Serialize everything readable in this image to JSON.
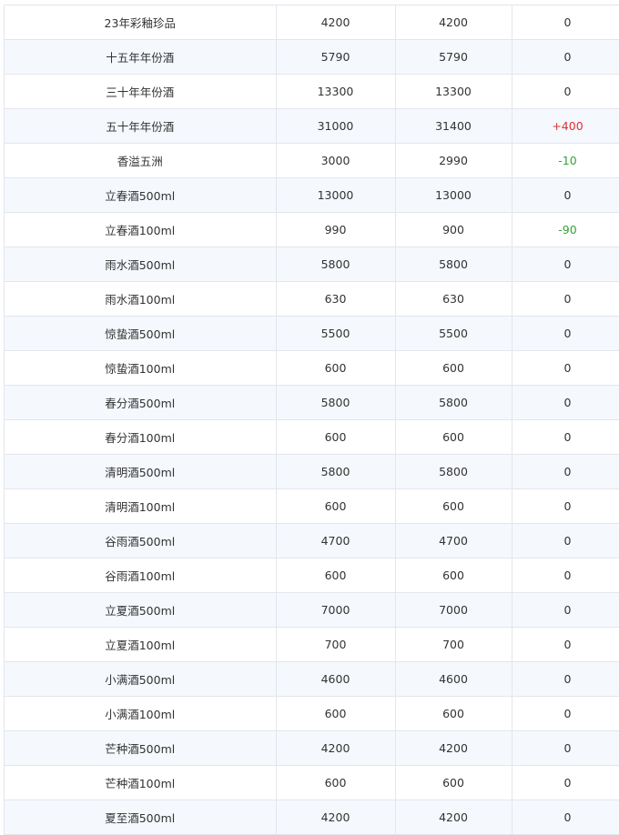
{
  "colors": {
    "up": "#e03131",
    "down": "#35a335",
    "neutral": "#333333",
    "stripe": "#f5f8fd",
    "border": "#e3e6ec"
  },
  "rows": [
    {
      "name": "23年彩釉珍品",
      "prev": "4200",
      "curr": "4200",
      "diff": "0"
    },
    {
      "name": "十五年年份酒",
      "prev": "5790",
      "curr": "5790",
      "diff": "0"
    },
    {
      "name": "三十年年份酒",
      "prev": "13300",
      "curr": "13300",
      "diff": "0"
    },
    {
      "name": "五十年年份酒",
      "prev": "31000",
      "curr": "31400",
      "diff": "+400"
    },
    {
      "name": "香溢五洲",
      "prev": "3000",
      "curr": "2990",
      "diff": "-10"
    },
    {
      "name": "立春酒500ml",
      "prev": "13000",
      "curr": "13000",
      "diff": "0"
    },
    {
      "name": "立春酒100ml",
      "prev": "990",
      "curr": "900",
      "diff": "-90"
    },
    {
      "name": "雨水酒500ml",
      "prev": "5800",
      "curr": "5800",
      "diff": "0"
    },
    {
      "name": "雨水酒100ml",
      "prev": "630",
      "curr": "630",
      "diff": "0"
    },
    {
      "name": "惊蛰酒500ml",
      "prev": "5500",
      "curr": "5500",
      "diff": "0"
    },
    {
      "name": "惊蛰酒100ml",
      "prev": "600",
      "curr": "600",
      "diff": "0"
    },
    {
      "name": "春分酒500ml",
      "prev": "5800",
      "curr": "5800",
      "diff": "0"
    },
    {
      "name": "春分酒100ml",
      "prev": "600",
      "curr": "600",
      "diff": "0"
    },
    {
      "name": "清明酒500ml",
      "prev": "5800",
      "curr": "5800",
      "diff": "0"
    },
    {
      "name": "清明酒100ml",
      "prev": "600",
      "curr": "600",
      "diff": "0"
    },
    {
      "name": "谷雨酒500ml",
      "prev": "4700",
      "curr": "4700",
      "diff": "0"
    },
    {
      "name": "谷雨酒100ml",
      "prev": "600",
      "curr": "600",
      "diff": "0"
    },
    {
      "name": "立夏酒500ml",
      "prev": "7000",
      "curr": "7000",
      "diff": "0"
    },
    {
      "name": "立夏酒100ml",
      "prev": "700",
      "curr": "700",
      "diff": "0"
    },
    {
      "name": "小满酒500ml",
      "prev": "4600",
      "curr": "4600",
      "diff": "0"
    },
    {
      "name": "小满酒100ml",
      "prev": "600",
      "curr": "600",
      "diff": "0"
    },
    {
      "name": "芒种酒500ml",
      "prev": "4200",
      "curr": "4200",
      "diff": "0"
    },
    {
      "name": "芒种酒100ml",
      "prev": "600",
      "curr": "600",
      "diff": "0"
    },
    {
      "name": "夏至酒500ml",
      "prev": "4200",
      "curr": "4200",
      "diff": "0"
    }
  ]
}
